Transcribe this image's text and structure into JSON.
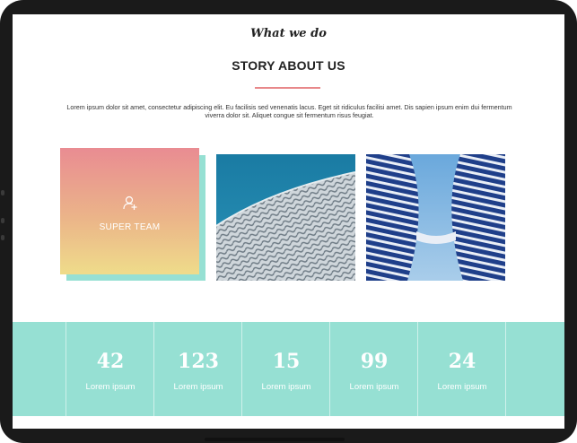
{
  "header": {
    "eyebrow": "What we do",
    "title": "STORY ABOUT US",
    "intro": "Lorem ipsum dolor sit amet, consectetur adipiscing elit. Eu facilisis sed venenatis lacus. Eget sit ridiculus facilisi amet. Dis sapien ipsum enim dui fermentum viverra dolor sit. Aliquet congue sit fermentum risus feugiat."
  },
  "feature_card": {
    "label": "SUPER TEAM",
    "icon": "add-user-icon"
  },
  "stats": [
    {
      "value": "42",
      "label": "Lorem ipsum"
    },
    {
      "value": "123",
      "label": "Lorem ipsum"
    },
    {
      "value": "15",
      "label": "Lorem ipsum"
    },
    {
      "value": "99",
      "label": "Lorem ipsum"
    },
    {
      "value": "24",
      "label": "Lorem ipsum"
    }
  ],
  "colors": {
    "accent_line": "#e8888a",
    "stats_band": "#96e0d3",
    "card_gradient_top": "#e98c92",
    "card_gradient_bottom": "#efdc8a"
  }
}
